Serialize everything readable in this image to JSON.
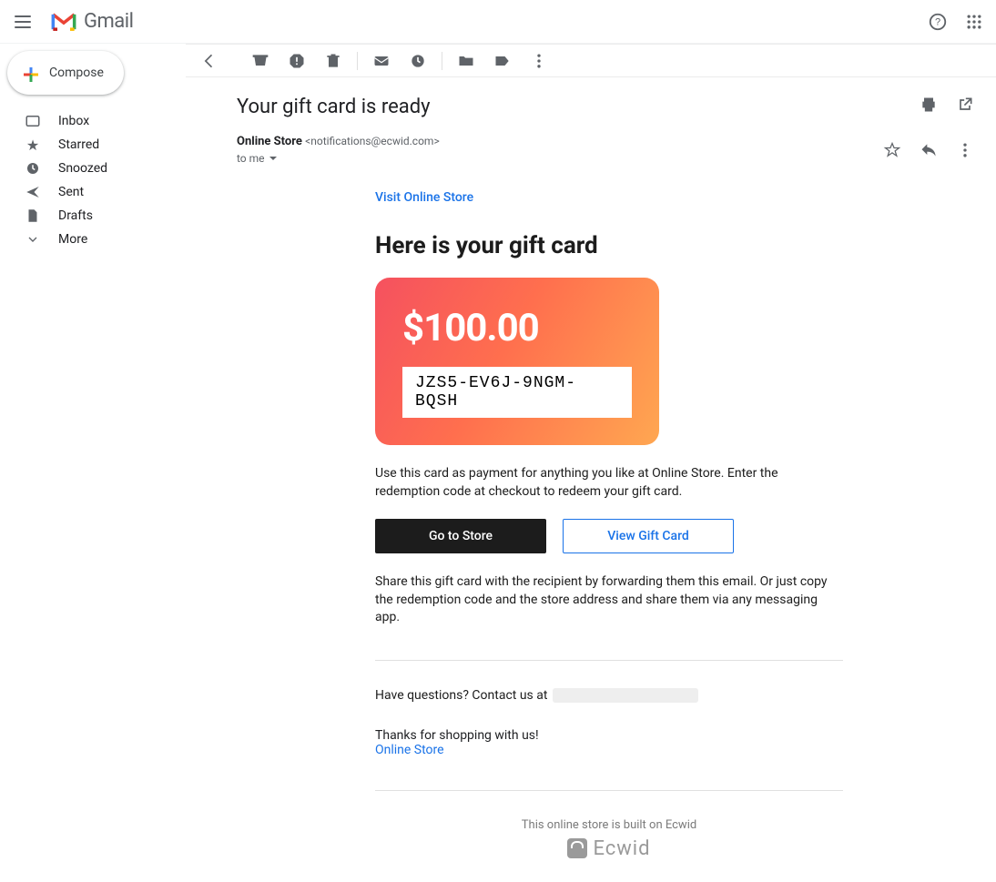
{
  "app": {
    "name": "Gmail"
  },
  "sidebar": {
    "compose": "Compose",
    "items": [
      {
        "label": "Inbox"
      },
      {
        "label": "Starred"
      },
      {
        "label": "Snoozed"
      },
      {
        "label": "Sent"
      },
      {
        "label": "Drafts"
      },
      {
        "label": "More"
      }
    ]
  },
  "message": {
    "subject": "Your gift card is ready",
    "sender_name": "Online Store",
    "sender_email": "<notifications@ecwid.com>",
    "to_line": "to me"
  },
  "email": {
    "visit_link": "Visit Online Store",
    "heading": "Here is your gift card",
    "amount": "$100.00",
    "code": "JZS5-EV6J-9NGM-BQSH",
    "desc": "Use this card as payment for anything you like at Online Store. Enter the redemption code at checkout to redeem your gift card.",
    "btn_primary": "Go to Store",
    "btn_secondary": "View Gift Card",
    "share": "Share this gift card with the recipient by forwarding them this email. Or just copy the redemption code and the store address and share them via any messaging app.",
    "questions_prefix": "Have questions? Contact us at",
    "thanks": "Thanks for shopping with us!",
    "store_link": "Online Store",
    "footer": "This online store is built on Ecwid",
    "ecwid": "Ecwid"
  }
}
